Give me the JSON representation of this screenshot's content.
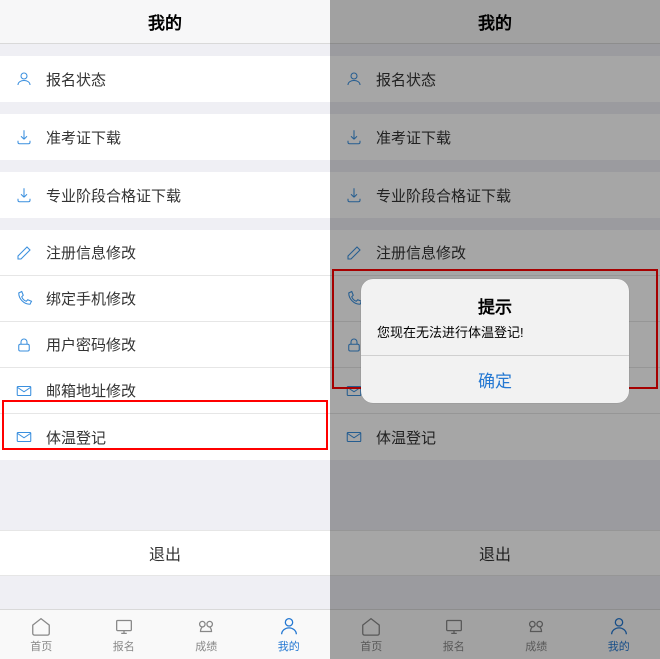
{
  "header": {
    "title": "我的"
  },
  "menu": [
    {
      "label": "报名状态",
      "icon": "user-icon"
    },
    {
      "label": "准考证下载",
      "icon": "download-icon"
    },
    {
      "label": "专业阶段合格证下载",
      "icon": "download-icon"
    },
    {
      "label": "注册信息修改",
      "icon": "edit-icon"
    },
    {
      "label": "绑定手机修改",
      "icon": "phone-icon"
    },
    {
      "label": "用户密码修改",
      "icon": "lock-icon"
    },
    {
      "label": "邮箱地址修改",
      "icon": "mail-icon"
    },
    {
      "label": "体温登记",
      "icon": "mail-icon"
    }
  ],
  "logout": "退出",
  "tabs": [
    {
      "label": "首页",
      "icon": "home-icon",
      "active": false
    },
    {
      "label": "报名",
      "icon": "signup-icon",
      "active": false
    },
    {
      "label": "成绩",
      "icon": "score-icon",
      "active": false
    },
    {
      "label": "我的",
      "icon": "person-icon",
      "active": true
    }
  ],
  "alert": {
    "title": "提示",
    "message": "您现在无法进行体温登记!",
    "confirm": "确定"
  }
}
